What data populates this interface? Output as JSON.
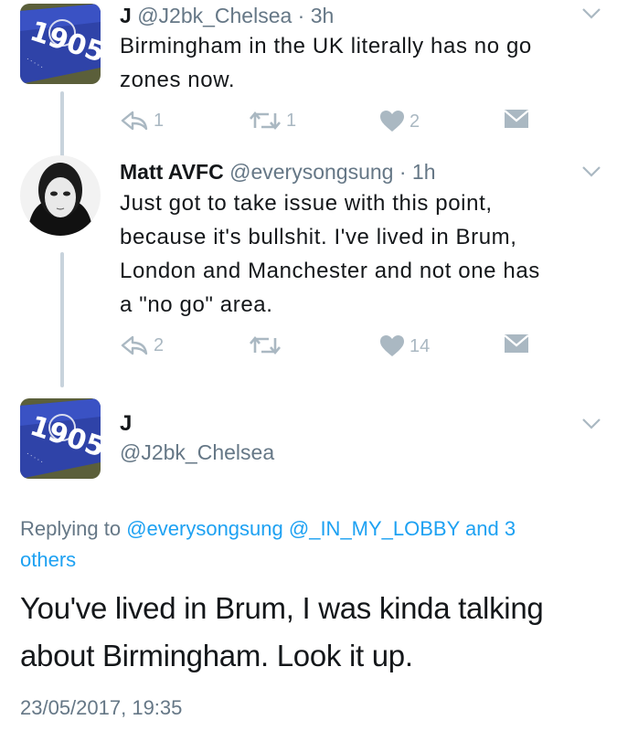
{
  "tweets": [
    {
      "name": "J",
      "handle": "@J2bk_Chelsea",
      "time": "3h",
      "text_lines": [
        "Birmingham in the UK literally has no go",
        "zones now."
      ],
      "reply_count": "1",
      "retweet_count": "1",
      "like_count": "2"
    },
    {
      "name": "Matt AVFC",
      "handle": "@everysongsung",
      "time": "1h",
      "text_lines": [
        "Just got to take issue with this point,",
        "because it's bullshit. I've lived in Brum,",
        "London and Manchester and not one has",
        "a \"no go\" area."
      ],
      "reply_count": "2",
      "retweet_count": "",
      "like_count": "14"
    }
  ],
  "detail": {
    "name": "J",
    "handle": "@J2bk_Chelsea",
    "replying_prefix": "Replying to",
    "replying_user1": "@everysongsung",
    "replying_user2": "@_IN_MY_LOBBY",
    "replying_and": "and 3",
    "replying_others": "others",
    "text_lines": [
      "You've lived in Brum, I was kinda talking",
      "about Birmingham. Look it up."
    ],
    "timestamp": "23/05/2017, 19:35"
  },
  "avatar_text": "1905",
  "colors": {
    "action_grey": "#aab8c2",
    "link_blue": "#1da1f2",
    "secondary_grey": "#657786",
    "thread_line": "#c8d3dc"
  }
}
